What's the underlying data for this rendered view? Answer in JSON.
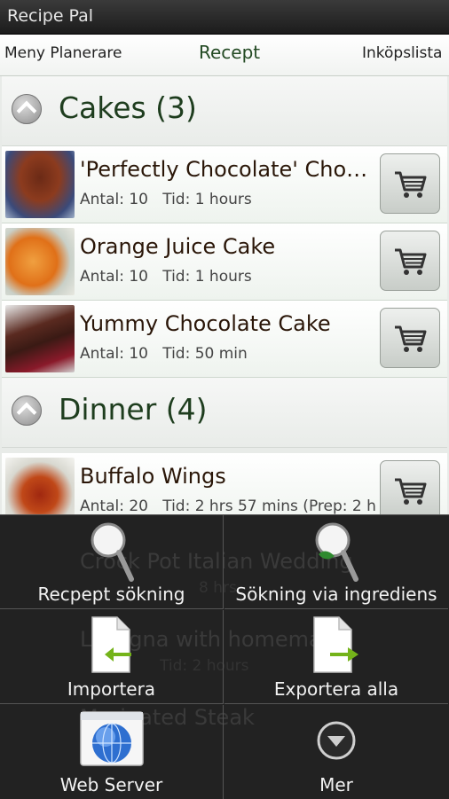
{
  "app": {
    "title": "Recipe Pal"
  },
  "tabs": [
    {
      "label": "Meny Planerare"
    },
    {
      "label": "Recept",
      "active": true
    },
    {
      "label": "Inköpslista"
    }
  ],
  "groups": [
    {
      "title": "Cakes (3)",
      "recipes": [
        {
          "title": "'Perfectly Chocolate' Chocolate Cake",
          "antal": "Antal: 10",
          "tid": "Tid: 1 hours"
        },
        {
          "title": "Orange Juice Cake",
          "antal": "Antal: 10",
          "tid": "Tid: 1 hours"
        },
        {
          "title": "Yummy Chocolate Cake",
          "antal": "Antal: 10",
          "tid": "Tid: 50 min"
        }
      ]
    },
    {
      "title": "Dinner (4)",
      "recipes": [
        {
          "title": "Buffalo Wings",
          "antal": "Antal: 20",
          "tid": "Tid: 2 hrs 57 mins (Prep: 2 h"
        }
      ]
    }
  ],
  "background_rows": [
    {
      "title": "Crock Pot Italian Wedding",
      "meta": "8 hrs"
    },
    {
      "title": "Lasagna with homemade",
      "meta": "Tid: 2 hours"
    },
    {
      "title": "Marinated Steak"
    }
  ],
  "menu": {
    "items": [
      {
        "label": "Recpept sökning",
        "icon": "magnifier-icon"
      },
      {
        "label": "Sökning via ingrediens",
        "icon": "magnifier-leaf-icon"
      },
      {
        "label": "Importera",
        "icon": "import-document-icon"
      },
      {
        "label": "Exportera alla",
        "icon": "export-document-icon"
      },
      {
        "label": "Web Server",
        "icon": "globe-window-icon"
      },
      {
        "label": "Mer",
        "icon": "more-chevron-icon"
      }
    ]
  },
  "colors": {
    "title_bar": "#1c1c1c",
    "tab_active": "#234a23",
    "group_title": "#1e3d1e",
    "menu_bg": "#0c0c0c"
  }
}
